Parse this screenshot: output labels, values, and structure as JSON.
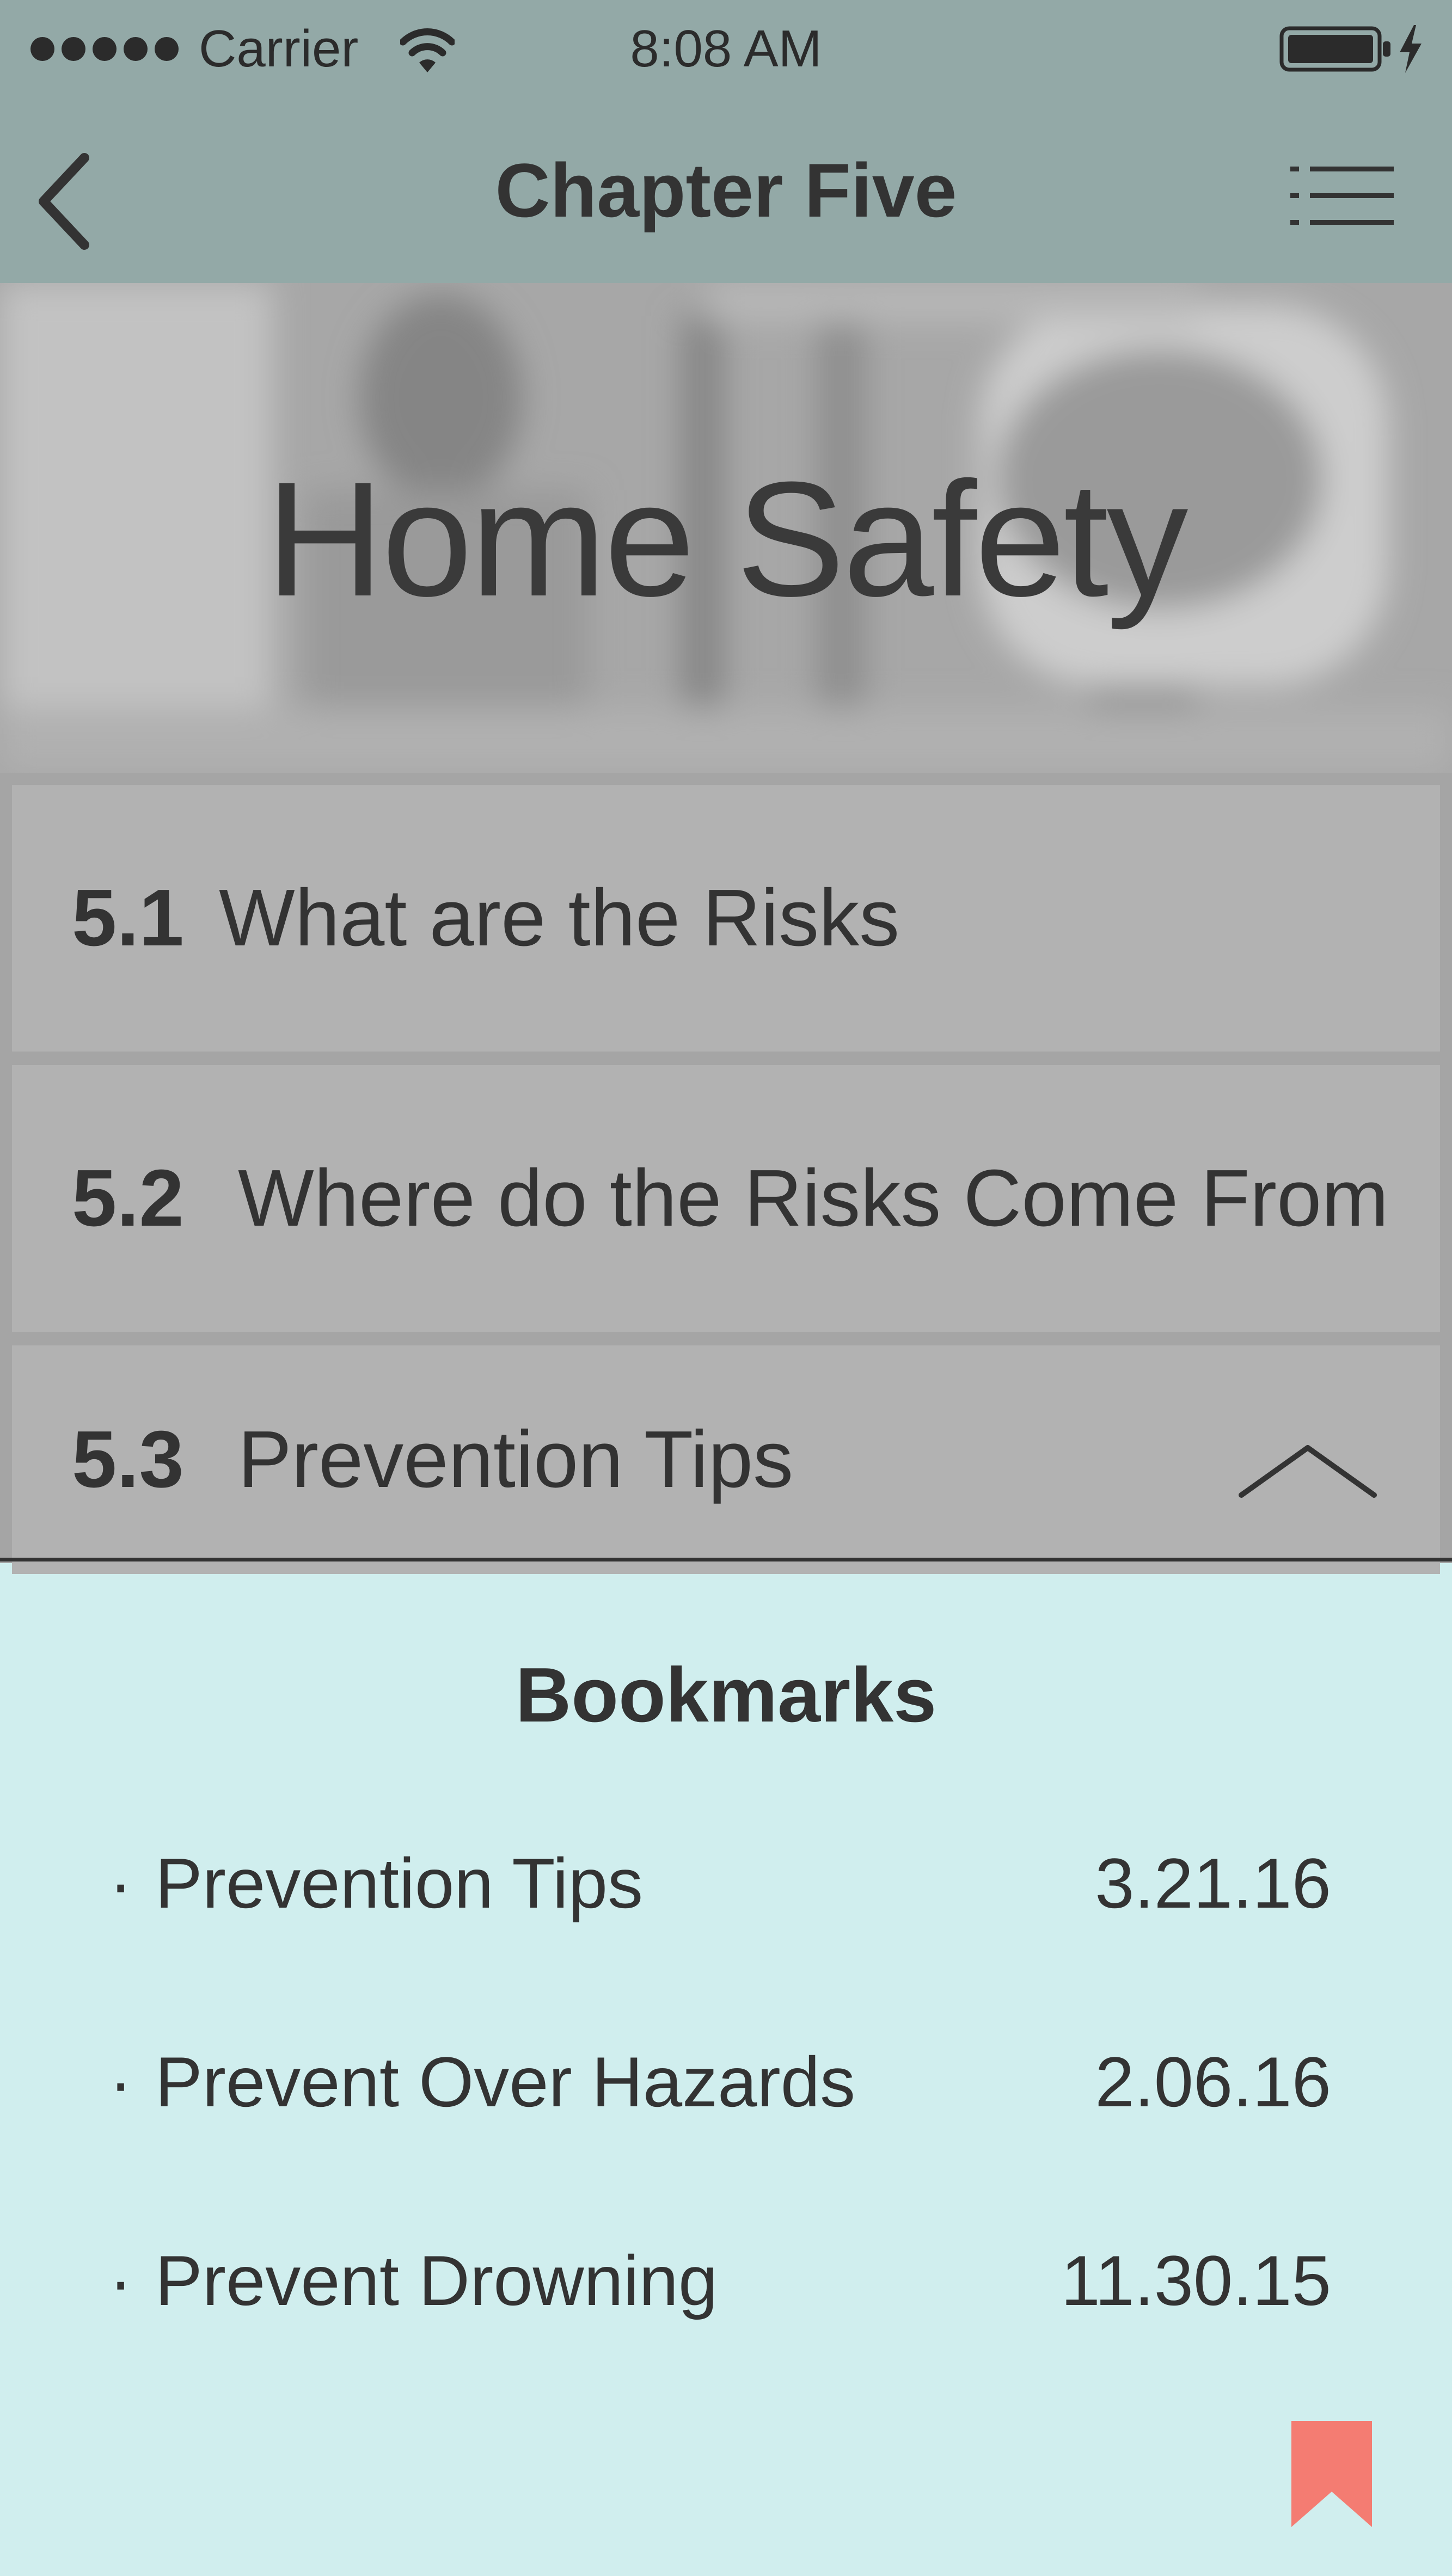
{
  "status_bar": {
    "carrier": "Carrier",
    "time": "8:08 AM",
    "signal_icon": "signal-dots-icon",
    "wifi_icon": "wifi-icon",
    "battery_icon": "battery-icon",
    "charging_icon": "bolt-icon"
  },
  "nav": {
    "title": "Chapter Five",
    "back_icon": "chevron-left-icon",
    "menu_icon": "list-icon"
  },
  "hero": {
    "title": "Home Safety"
  },
  "sections": [
    {
      "number": "5.1",
      "label": "What are the Risks"
    },
    {
      "number": "5.2",
      "label": "Where do the Risks Come From"
    },
    {
      "number": "5.3",
      "label": "Prevention Tips",
      "icon": "chevron-up-icon"
    }
  ],
  "bookmarks": {
    "title": "Bookmarks",
    "bullet": "·",
    "items": [
      {
        "title": "Prevention Tips",
        "date": "3.21.16"
      },
      {
        "title": "Prevent Over Hazards",
        "date": "2.06.16"
      },
      {
        "title": "Prevent Drowning",
        "date": "11.30.15"
      }
    ],
    "bookmark_icon": "bookmark-icon"
  },
  "colors": {
    "header_bg": "#93a9a7",
    "panel_bg": "#d0eeee",
    "row_bg": "#b2b2b2",
    "text": "#333333",
    "bookmark_accent": "#f47c72"
  }
}
